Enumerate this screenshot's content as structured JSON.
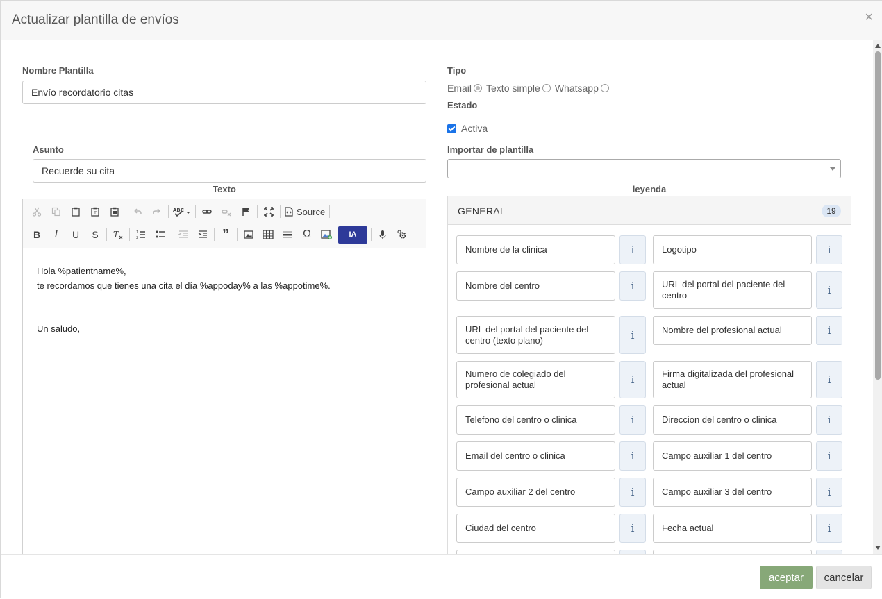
{
  "modal": {
    "title": "Actualizar plantilla de envíos",
    "close": "×"
  },
  "form": {
    "nombre_label": "Nombre Plantilla",
    "nombre_value": "Envío recordatorio citas",
    "tipo_label": "Tipo",
    "tipo_options": [
      "Email",
      "Texto simple",
      "Whatsapp"
    ],
    "tipo_selected": "Email",
    "estado_label": "Estado",
    "activa_label": "Activa",
    "importar_label": "Importar de plantilla",
    "importar_value": "",
    "asunto_label": "Asunto",
    "asunto_value": "Recuerde su cita",
    "texto_label": "Texto",
    "leyenda_label": "leyenda"
  },
  "editor": {
    "source_label": "Source",
    "ia_label": "IA",
    "lines": [
      "Hola %patientname%,",
      "te recordamos que tienes una cita el día %appoday% a las %appotime%.",
      "",
      "",
      "Un saludo,"
    ]
  },
  "legend": {
    "title": "GENERAL",
    "count": "19",
    "info_label": "i",
    "items": [
      "Nombre de la clinica",
      "Logotipo",
      "Nombre del centro",
      "URL del portal del paciente del centro",
      "URL del portal del paciente del centro (texto plano)",
      "Nombre del profesional actual",
      "Numero de colegiado del profesional actual",
      "Firma digitalizada del profesional actual",
      "Telefono del centro o clinica",
      "Direccion del centro o clinica",
      "Email del centro o clinica",
      "Campo auxiliar 1 del centro",
      "Campo auxiliar 2 del centro",
      "Campo auxiliar 3 del centro",
      "Ciudad del centro",
      "Fecha actual"
    ]
  },
  "footer": {
    "ok_label": "aceptar",
    "cancel_label": "cancelar"
  },
  "colors": {
    "ok": "#87a878",
    "ia": "#2e3a99",
    "checkbox": "#1a73e8"
  }
}
